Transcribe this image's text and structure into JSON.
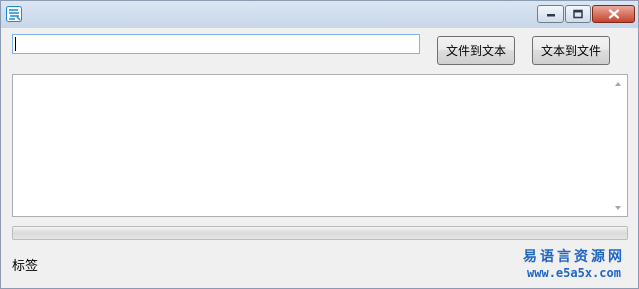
{
  "titlebar": {
    "icon": "app-icon",
    "buttons": [
      "minimize-icon",
      "maximize-icon",
      "close-icon"
    ]
  },
  "input": {
    "value": ""
  },
  "buttons": {
    "file_to_text": "文件到文本",
    "text_to_file": "文本到文件"
  },
  "textarea": {
    "value": ""
  },
  "progress": {
    "value": 0
  },
  "status": {
    "label": "标签"
  },
  "watermark": {
    "site_name": "易语言资源网",
    "url": "www.e5a5x.com"
  },
  "colors": {
    "accent": "#1f66c7",
    "input_focus_border": "#7eb4ea",
    "close_button": "#c7432d"
  }
}
